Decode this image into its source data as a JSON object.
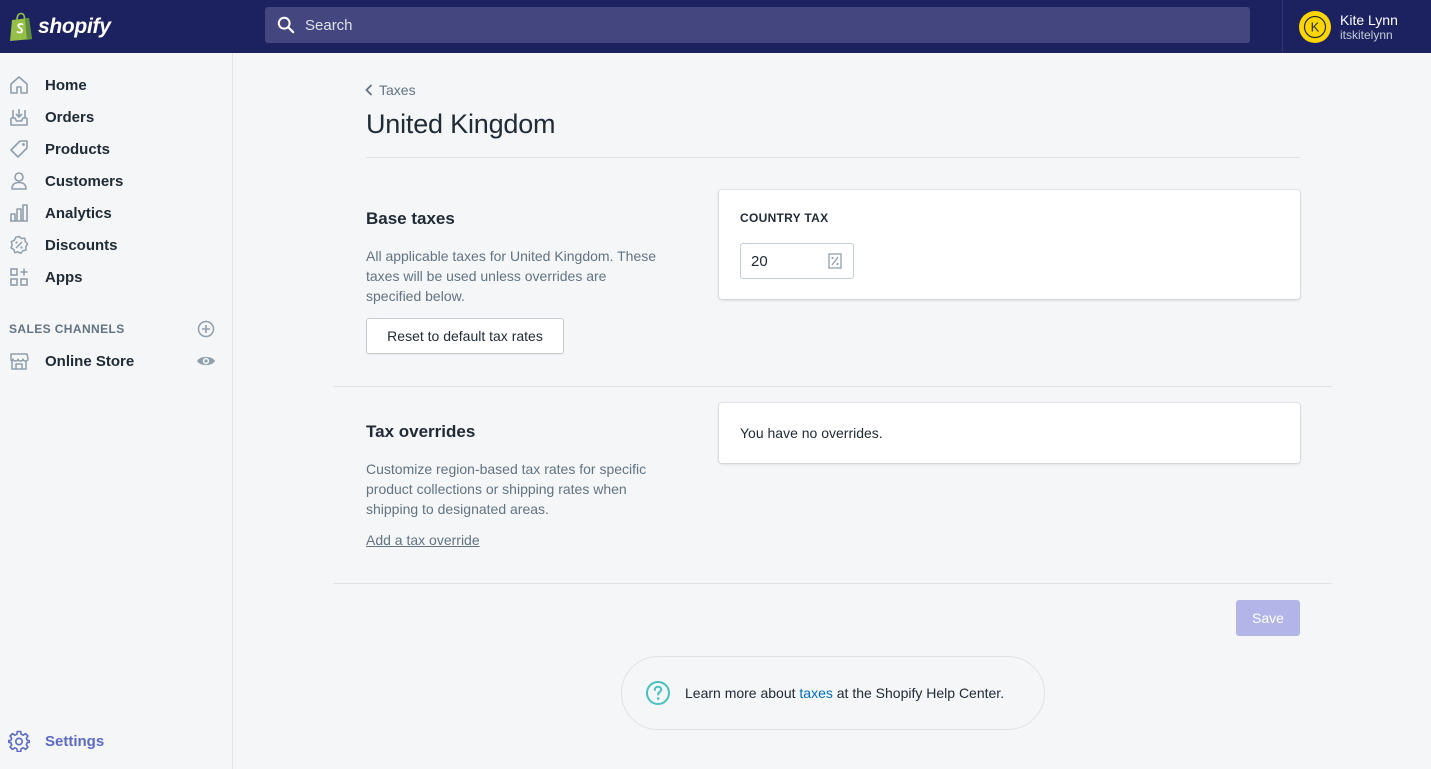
{
  "brand": {
    "name": "shopify",
    "accent": "#5c6ac4",
    "topbar_color": "#1c2260"
  },
  "search": {
    "placeholder": "Search"
  },
  "user": {
    "name": "Kite Lynn",
    "handle": "itskitelynn",
    "initials": "K"
  },
  "sidebar": {
    "items": [
      {
        "label": "Home",
        "icon": "home-icon"
      },
      {
        "label": "Orders",
        "icon": "orders-icon"
      },
      {
        "label": "Products",
        "icon": "tag-icon"
      },
      {
        "label": "Customers",
        "icon": "person-icon"
      },
      {
        "label": "Analytics",
        "icon": "bar-chart-icon"
      },
      {
        "label": "Discounts",
        "icon": "discount-icon"
      },
      {
        "label": "Apps",
        "icon": "apps-icon"
      }
    ],
    "sales_channels_title": "SALES CHANNELS",
    "channels": [
      {
        "label": "Online Store",
        "icon": "store-icon"
      }
    ],
    "settings_label": "Settings"
  },
  "page": {
    "breadcrumb": "Taxes",
    "title": "United Kingdom",
    "base_taxes": {
      "heading": "Base taxes",
      "description": "All applicable taxes for United Kingdom. These taxes will be used unless overrides are specified below.",
      "reset_button": "Reset to default tax rates",
      "country_tax_label": "COUNTRY TAX",
      "country_tax_value": "20"
    },
    "tax_overrides": {
      "heading": "Tax overrides",
      "description": "Customize region-based tax rates for specific product collections or shipping rates when shipping to designated areas.",
      "add_link": "Add a tax override",
      "empty_text": "You have no overrides."
    },
    "save_button": "Save",
    "help": {
      "prefix": "Learn more about ",
      "link": "taxes",
      "suffix": " at the Shopify Help Center."
    }
  }
}
